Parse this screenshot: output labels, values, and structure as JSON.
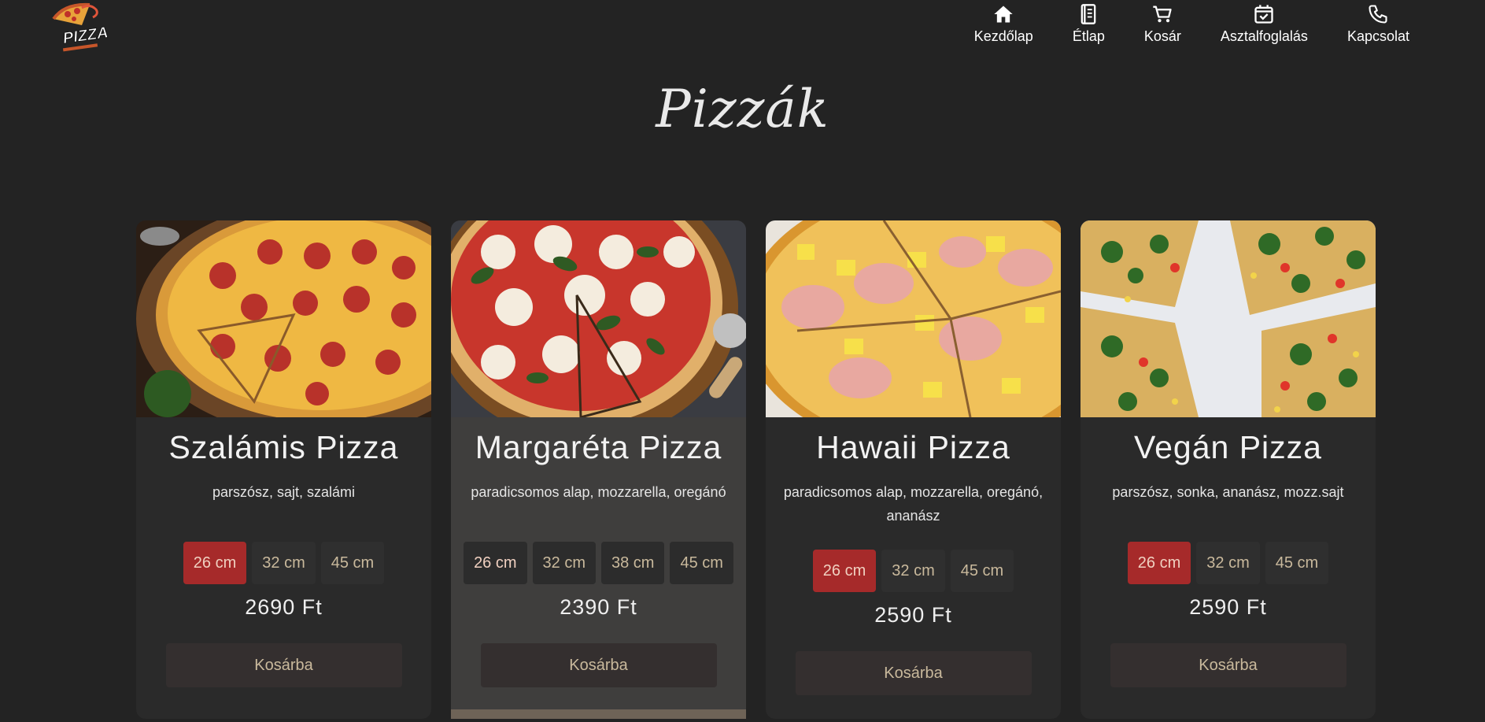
{
  "nav": {
    "items": [
      {
        "label": "Kezdőlap",
        "icon": "home-icon"
      },
      {
        "label": "Étlap",
        "icon": "menu-book-icon"
      },
      {
        "label": "Kosár",
        "icon": "cart-icon"
      },
      {
        "label": "Asztalfoglalás",
        "icon": "calendar-check-icon"
      },
      {
        "label": "Kapcsolat",
        "icon": "phone-icon"
      }
    ]
  },
  "logo": {
    "text": "PIZZA"
  },
  "page": {
    "title": "Pizzák"
  },
  "colors": {
    "background": "#232323",
    "card": "#2a2a2a",
    "card_hover": "#3f3e3d",
    "accent_active": "#a62a2a",
    "button": "#342f2f",
    "button_text": "#c9b99c"
  },
  "cards": [
    {
      "title": "Szalámis Pizza",
      "description": "parszósz, sajt, szalámi",
      "sizes": [
        "26 cm",
        "32 cm",
        "45 cm"
      ],
      "active_size": 0,
      "price": "2690 Ft",
      "cart_label": "Kosárba"
    },
    {
      "title": "Margaréta Pizza",
      "description": "paradicsomos alap, mozzarella, oregánó",
      "sizes": [
        "26 cm",
        "32 cm",
        "38 cm",
        "45 cm"
      ],
      "active_size": 0,
      "price": "2390 Ft",
      "cart_label": "Kosárba"
    },
    {
      "title": "Hawaii Pizza",
      "description": "paradicsomos alap, mozzarella, oregánó, ananász",
      "sizes": [
        "26 cm",
        "32 cm",
        "45 cm"
      ],
      "active_size": 0,
      "price": "2590 Ft",
      "cart_label": "Kosárba"
    },
    {
      "title": "Vegán Pizza",
      "description": "parszósz, sonka, ananász, mozz.sajt",
      "sizes": [
        "26 cm",
        "32 cm",
        "45 cm"
      ],
      "active_size": 0,
      "price": "2590 Ft",
      "cart_label": "Kosárba"
    }
  ]
}
